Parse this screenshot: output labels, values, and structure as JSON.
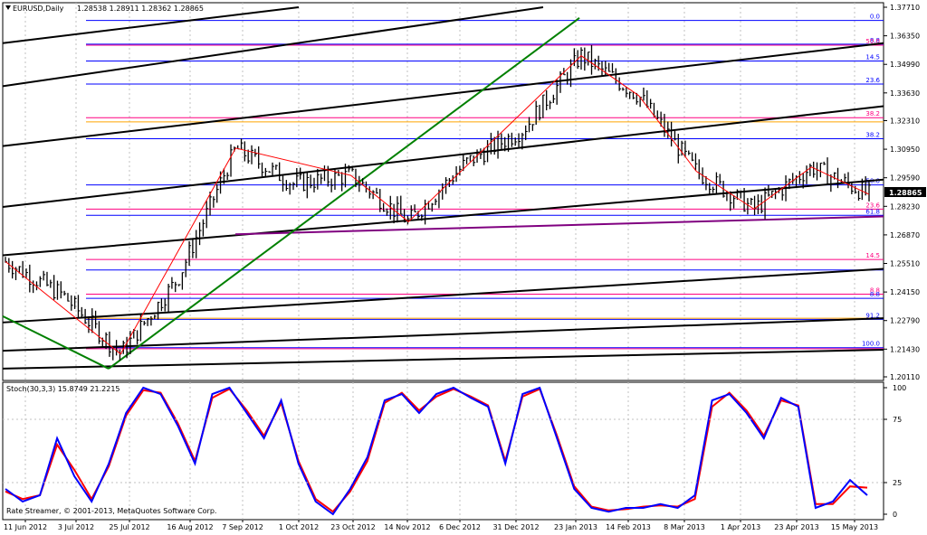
{
  "header": {
    "symbol": "EURUSD,Daily",
    "ohlc": "1.28538 1.28911 1.28362 1.28865"
  },
  "stoch_label": "Stoch(30,3,3) 15.8749 21.2215",
  "copyright": "Rate Streamer, © 2001-2013, MetaQuotes Software Corp.",
  "price_label": "1.28865",
  "colors": {
    "background": "#ffffff",
    "bars": "#000000",
    "fib_blue": "#0000ff",
    "fib_magenta": "#ff0080",
    "fib_orange": "#ffa500",
    "channel": "#000000",
    "green_line": "#008000",
    "zigzag": "#ff0000",
    "purple_line": "#800080",
    "stoch_main": "#0000ff",
    "stoch_signal": "#ff0000"
  },
  "chart_data": {
    "type": "line",
    "title": "EURUSD,Daily",
    "price_axis": {
      "ticks": [
        "1.37710",
        "1.36350",
        "1.34990",
        "1.33630",
        "1.32310",
        "1.30950",
        "1.29590",
        "1.28230",
        "1.26870",
        "1.25510",
        "1.24150",
        "1.22790",
        "1.21430",
        "1.20110"
      ],
      "ylim": [
        1.2011,
        1.3771
      ]
    },
    "x_ticks": [
      "11 Jun 2012",
      "3 Jul 2012",
      "25 Jul 2012",
      "16 Aug 2012",
      "7 Sep 2012",
      "1 Oct 2012",
      "23 Oct 2012",
      "14 Nov 2012",
      "6 Dec 2012",
      "31 Dec 2012",
      "23 Jan 2013",
      "14 Feb 2013",
      "8 Mar 2013",
      "1 Apr 2013",
      "23 Apr 2013",
      "15 May 2013"
    ],
    "price_series": {
      "name": "EURUSD Daily close",
      "x": [
        "11 Jun 2012",
        "3 Jul 2012",
        "25 Jul 2012",
        "16 Aug 2012",
        "7 Sep 2012",
        "1 Oct 2012",
        "23 Oct 2012",
        "14 Nov 2012",
        "6 Dec 2012",
        "31 Dec 2012",
        "23 Jan 2013",
        "14 Feb 2013",
        "8 Mar 2013",
        "1 Apr 2013",
        "23 Apr 2013",
        "15 May 2013"
      ],
      "values": [
        1.256,
        1.24,
        1.212,
        1.248,
        1.31,
        1.293,
        1.297,
        1.275,
        1.303,
        1.319,
        1.354,
        1.335,
        1.299,
        1.281,
        1.301,
        1.288
      ]
    },
    "fib_levels": [
      {
        "label": "0.0",
        "price": 1.3708,
        "color": "#0000ff"
      },
      {
        "label": "8.8",
        "price": 1.3595,
        "color": "#0000ff"
      },
      {
        "label": "50.0",
        "price": 1.359,
        "color": "#ff0080"
      },
      {
        "label": "14.5",
        "price": 1.3515,
        "color": "#0000ff"
      },
      {
        "label": "23.6",
        "price": 1.3405,
        "color": "#0000ff"
      },
      {
        "label": "38.2",
        "price": 1.3245,
        "color": "#ff0080"
      },
      {
        "label": "",
        "price": 1.3225,
        "color": "#ffa500"
      },
      {
        "label": "38.2",
        "price": 1.3145,
        "color": "#0000ff"
      },
      {
        "label": "50.0",
        "price": 1.2925,
        "color": "#0000ff"
      },
      {
        "label": "23.6",
        "price": 1.281,
        "color": "#ff0080"
      },
      {
        "label": "61.8",
        "price": 1.278,
        "color": "#0000ff"
      },
      {
        "label": "14.5",
        "price": 1.257,
        "color": "#ff0080"
      },
      {
        "label": "",
        "price": 1.252,
        "color": "#0000ff"
      },
      {
        "label": "8.8",
        "price": 1.2405,
        "color": "#ff0080"
      },
      {
        "label": "8.8",
        "price": 1.2385,
        "color": "#0000ff"
      },
      {
        "label": "91.2",
        "price": 1.2285,
        "color": "#0000ff"
      },
      {
        "label": "",
        "price": 1.229,
        "color": "#ffa500"
      },
      {
        "label": "100.0",
        "price": 1.215,
        "color": "#0000ff"
      },
      {
        "label": "",
        "price": 1.2145,
        "color": "#ff0080"
      }
    ],
    "stochastic": {
      "name": "Stoch(30,3,3)",
      "ticks": [
        "100",
        "75",
        "25",
        "0"
      ],
      "ylim": [
        0,
        100
      ],
      "main": [
        20,
        10,
        15,
        60,
        30,
        10,
        40,
        80,
        100,
        95,
        70,
        40,
        95,
        100,
        80,
        60,
        90,
        40,
        10,
        0,
        20,
        45,
        90,
        95,
        80,
        95,
        100,
        92,
        85,
        40,
        95,
        100,
        60,
        20,
        5,
        2,
        5,
        5,
        8,
        5,
        15,
        90,
        95,
        80,
        60,
        92,
        85,
        5,
        10,
        27,
        15
      ],
      "signal": [
        18,
        12,
        15,
        55,
        35,
        12,
        38,
        78,
        98,
        96,
        72,
        42,
        92,
        99,
        82,
        62,
        88,
        42,
        12,
        2,
        18,
        42,
        88,
        96,
        82,
        93,
        99,
        93,
        86,
        42,
        93,
        99,
        62,
        22,
        6,
        3,
        4,
        6,
        7,
        6,
        12,
        85,
        96,
        82,
        62,
        90,
        86,
        8,
        8,
        22,
        21
      ]
    }
  }
}
